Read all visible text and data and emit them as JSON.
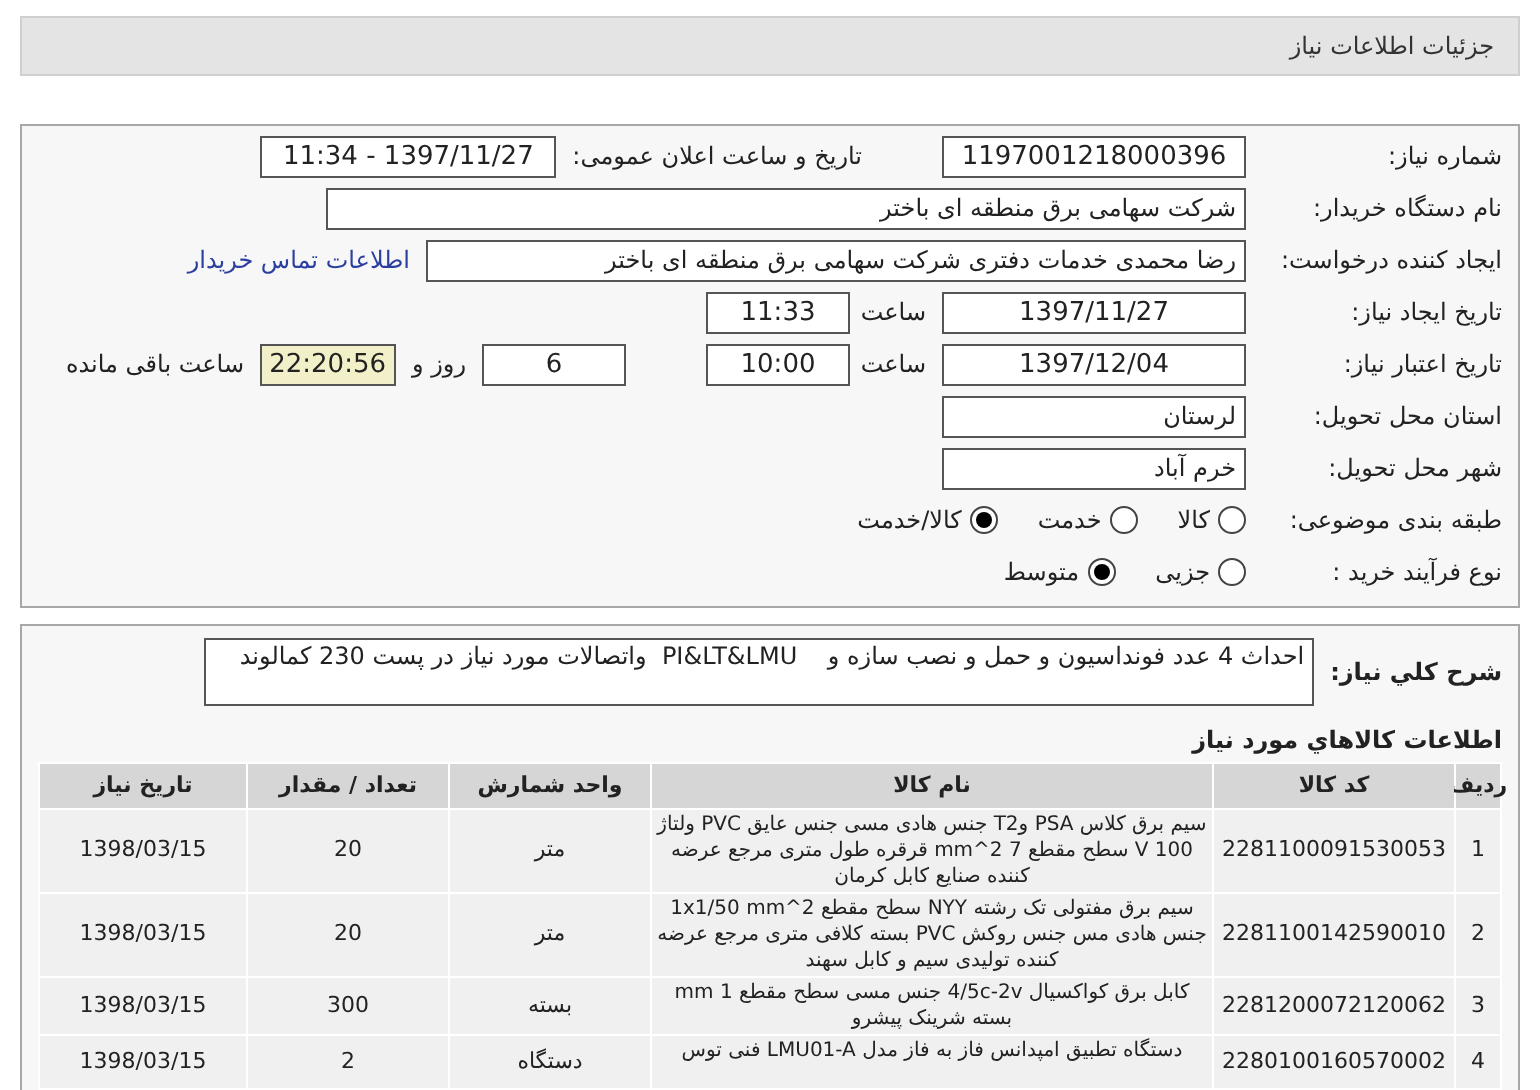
{
  "header": {
    "title": "جزئیات اطلاعات نیاز"
  },
  "details": {
    "need_number": {
      "label": "شماره نیاز:",
      "value": "1197001218000396"
    },
    "announce": {
      "label": "تاریخ و ساعت اعلان عمومی:",
      "value": "1397/11/27 - 11:34"
    },
    "buyer": {
      "label": "نام دستگاه خریدار:",
      "value": "شرکت سهامی برق منطقه ای باختر"
    },
    "requester": {
      "label": "ایجاد کننده درخواست:",
      "value": "رضا محمدی خدمات دفتری شرکت سهامی برق منطقه ای باختر",
      "link": "اطلاعات تماس خریدار"
    },
    "created": {
      "label": "تاریخ ایجاد نیاز:",
      "date": "1397/11/27",
      "time_label": "ساعت",
      "time": "11:33"
    },
    "validity": {
      "label": "تاریخ اعتبار نیاز:",
      "date": "1397/12/04",
      "time_label": "ساعت",
      "time": "10:00",
      "days": "6",
      "days_label": "روز و",
      "remaining": "22:20:56",
      "remaining_label": "ساعت باقی مانده"
    },
    "province": {
      "label": "استان محل تحویل:",
      "value": "لرستان"
    },
    "city": {
      "label": "شهر محل تحویل:",
      "value": "خرم آباد"
    },
    "category": {
      "label": "طبقه بندی موضوعی:",
      "options": [
        {
          "label": "کالا",
          "selected": false
        },
        {
          "label": "خدمت",
          "selected": false
        },
        {
          "label": "کالا/خدمت",
          "selected": true
        }
      ]
    },
    "process": {
      "label": "نوع فرآیند خرید :",
      "options": [
        {
          "label": "جزیی",
          "selected": false
        },
        {
          "label": "متوسط",
          "selected": true
        }
      ]
    }
  },
  "description": {
    "label": "شرح کلي نياز:",
    "value": "احداث 4 عدد فونداسیون و حمل و نصب سازه و    PI&LT&LMU  واتصالات مورد نیاز در پست 230 کمالوند"
  },
  "goods": {
    "title": "اطلاعات کالاهاي مورد نياز",
    "columns": [
      "ردیف",
      "کد کالا",
      "نام کالا",
      "واحد شمارش",
      "تعداد / مقدار",
      "تاریخ نیاز"
    ],
    "rows": [
      [
        "1",
        "2281100091530053",
        "سیم برق کلاس PSA وT2 جنس هادی مسی جنس عایق PVC ولتاژ 100 V سطح مقطع 7 mm^2 قرقره طول متری مرجع عرضه کننده صنایع کابل کرمان",
        "متر",
        "20",
        "1398/03/15"
      ],
      [
        "2",
        "2281100142590010",
        "سیم برق مفتولی تک رشته NYY سطح مقطع 1x1/50 mm^2 جنس هادی مس جنس روکش PVC بسته کلافی متری مرجع عرضه کننده تولیدی سیم و کابل سهند",
        "متر",
        "20",
        "1398/03/15"
      ],
      [
        "3",
        "2281200072120062",
        "کابل برق کواکسیال 4/5c-2v جنس مسی سطح مقطع 1 mm بسته شرینک پیشرو",
        "بسته",
        "300",
        "1398/03/15"
      ],
      [
        "4",
        "2280100160570002",
        "دستگاه تطبیق امپدانس فاز به فاز مدل LMU01-A فنی توس",
        "دستگاه",
        "2",
        "1398/03/15"
      ]
    ]
  }
}
